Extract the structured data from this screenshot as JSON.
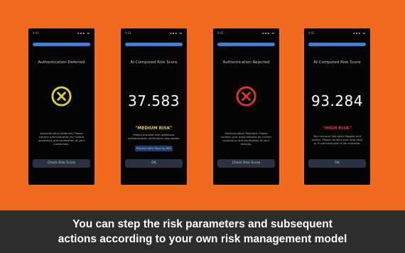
{
  "colors": {
    "background": "#f06a1f",
    "caption_bg": "#2d2d2d",
    "accent_blue": "#3f7fd7",
    "medium_risk": "#e6c93a",
    "high_risk": "#e0322f",
    "defer_icon": "#d8cf3c"
  },
  "phones": [
    {
      "status_time": "9:41",
      "status_signal": "▪▪▪ ▬",
      "title": "Authentication Deferred",
      "icon": "circle-x-icon",
      "body": "Authentication Deferred: Please contact administration for further assistance and verification of your credentials.",
      "button": "Check Risk Score"
    },
    {
      "status_time": "9:41",
      "status_signal": "▪▪▪ ▬",
      "title": "AI-Computed Risk Score",
      "score": "37.583",
      "risk_label": "\"MEDIUM RISK\"",
      "body": "Please proceed with additional authentication verification step below.",
      "mini_button": "Proceed with Step-Up MFA",
      "button": "OK"
    },
    {
      "status_time": "9:41",
      "status_signal": "▪▪▪ ▬",
      "title": "Authentication Rejected",
      "icon": "circle-x-icon",
      "body": "Authentication Rejected: Please contact your administrator for further assistance and verification of your identity.",
      "button": "Check Risk Score"
    },
    {
      "status_time": "9:41",
      "status_signal": "▪▪▪ ▬",
      "title": "AI-Computed Risk Score",
      "score": "93.284",
      "risk_label": "\"HIGH RISK\"",
      "body": "Your account has been flagged and locked. Please contact your help desk or IT administrator to be unlocked.",
      "button": "OK"
    }
  ],
  "caption": {
    "line1": "You can step the risk parameters and subsequent",
    "line2": "actions according to your own risk management model"
  }
}
